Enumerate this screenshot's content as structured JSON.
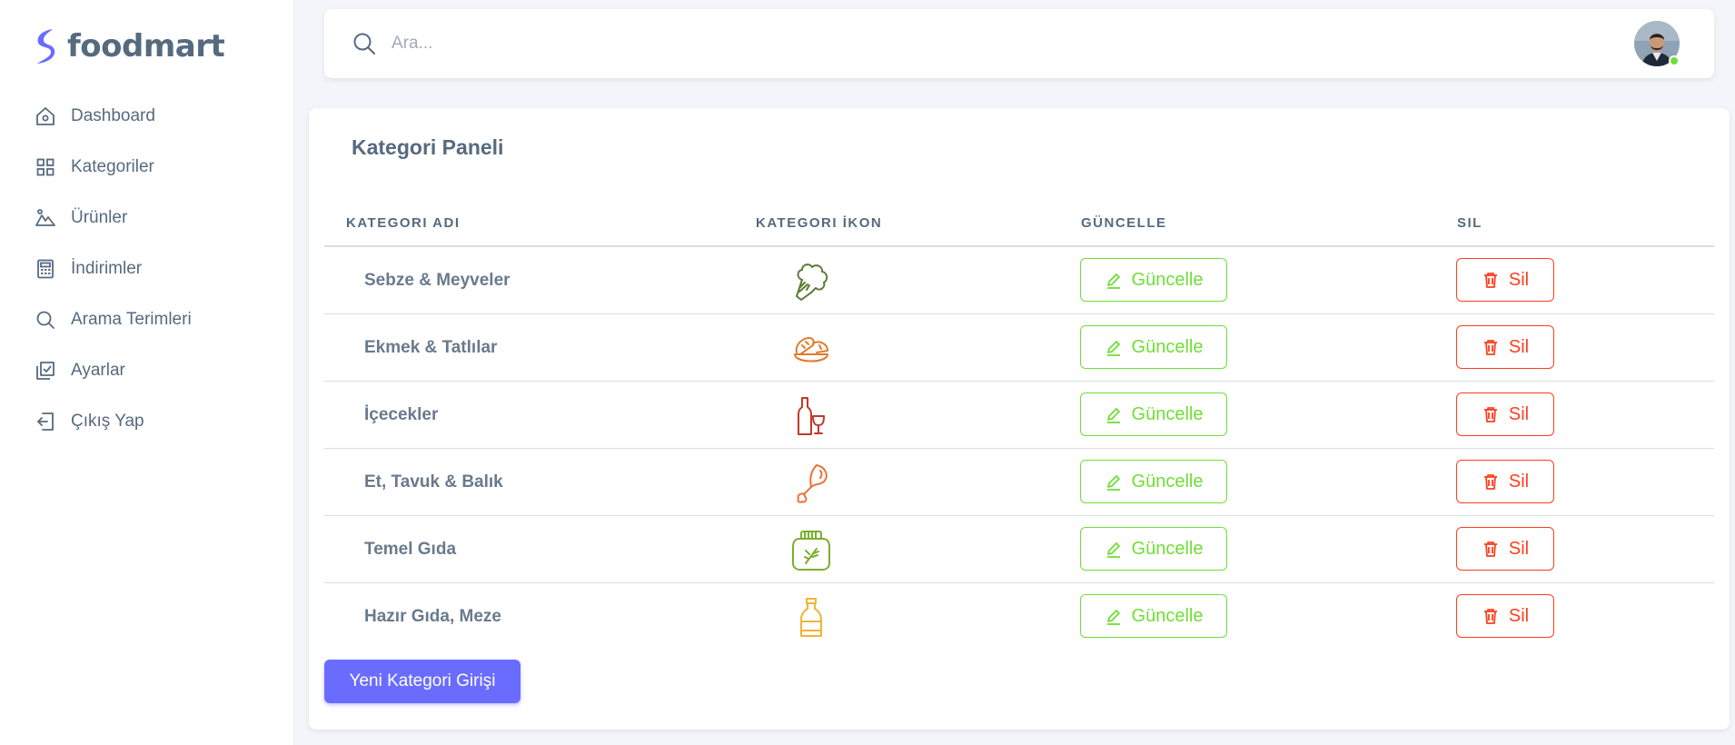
{
  "brand": {
    "name": "foodmart",
    "accent": "#696cff"
  },
  "sidebar": {
    "items": [
      {
        "label": "Dashboard",
        "icon": "home-icon"
      },
      {
        "label": "Kategoriler",
        "icon": "grid-icon"
      },
      {
        "label": "Ürünler",
        "icon": "landscape-icon"
      },
      {
        "label": "İndirimler",
        "icon": "calculator-icon"
      },
      {
        "label": "Arama Terimleri",
        "icon": "search-icon"
      },
      {
        "label": "Ayarlar",
        "icon": "check-square-icon"
      },
      {
        "label": "Çıkış Yap",
        "icon": "logout-icon"
      }
    ]
  },
  "search": {
    "placeholder": "Ara...",
    "value": ""
  },
  "user": {
    "status": "online",
    "status_color": "#71dd37"
  },
  "panel": {
    "title": "Kategori Paneli",
    "columns": [
      "KATEGORI ADI",
      "KATEGORI İKON",
      "GÜNCELLE",
      "SIL"
    ],
    "rows": [
      {
        "name": "Sebze & Meyveler",
        "icon": "broccoli-icon",
        "icon_color": "#5a7a35"
      },
      {
        "name": "Ekmek & Tatlılar",
        "icon": "bread-icon",
        "icon_color": "#e07b2a"
      },
      {
        "name": "İçecekler",
        "icon": "wine-icon",
        "icon_color": "#c0392b"
      },
      {
        "name": "Et, Tavuk & Balık",
        "icon": "chicken-leg-icon",
        "icon_color": "#e8743b"
      },
      {
        "name": "Temel Gıda",
        "icon": "jar-icon",
        "icon_color": "#7cae2e"
      },
      {
        "name": "Hazır Gıda, Meze",
        "icon": "bottle-icon",
        "icon_color": "#f0b33a"
      }
    ],
    "update_label": "Güncelle",
    "delete_label": "Sil",
    "update_color": "#71dd37",
    "delete_color": "#ff3e1d",
    "new_button_label": "Yeni Kategori Girişi"
  }
}
